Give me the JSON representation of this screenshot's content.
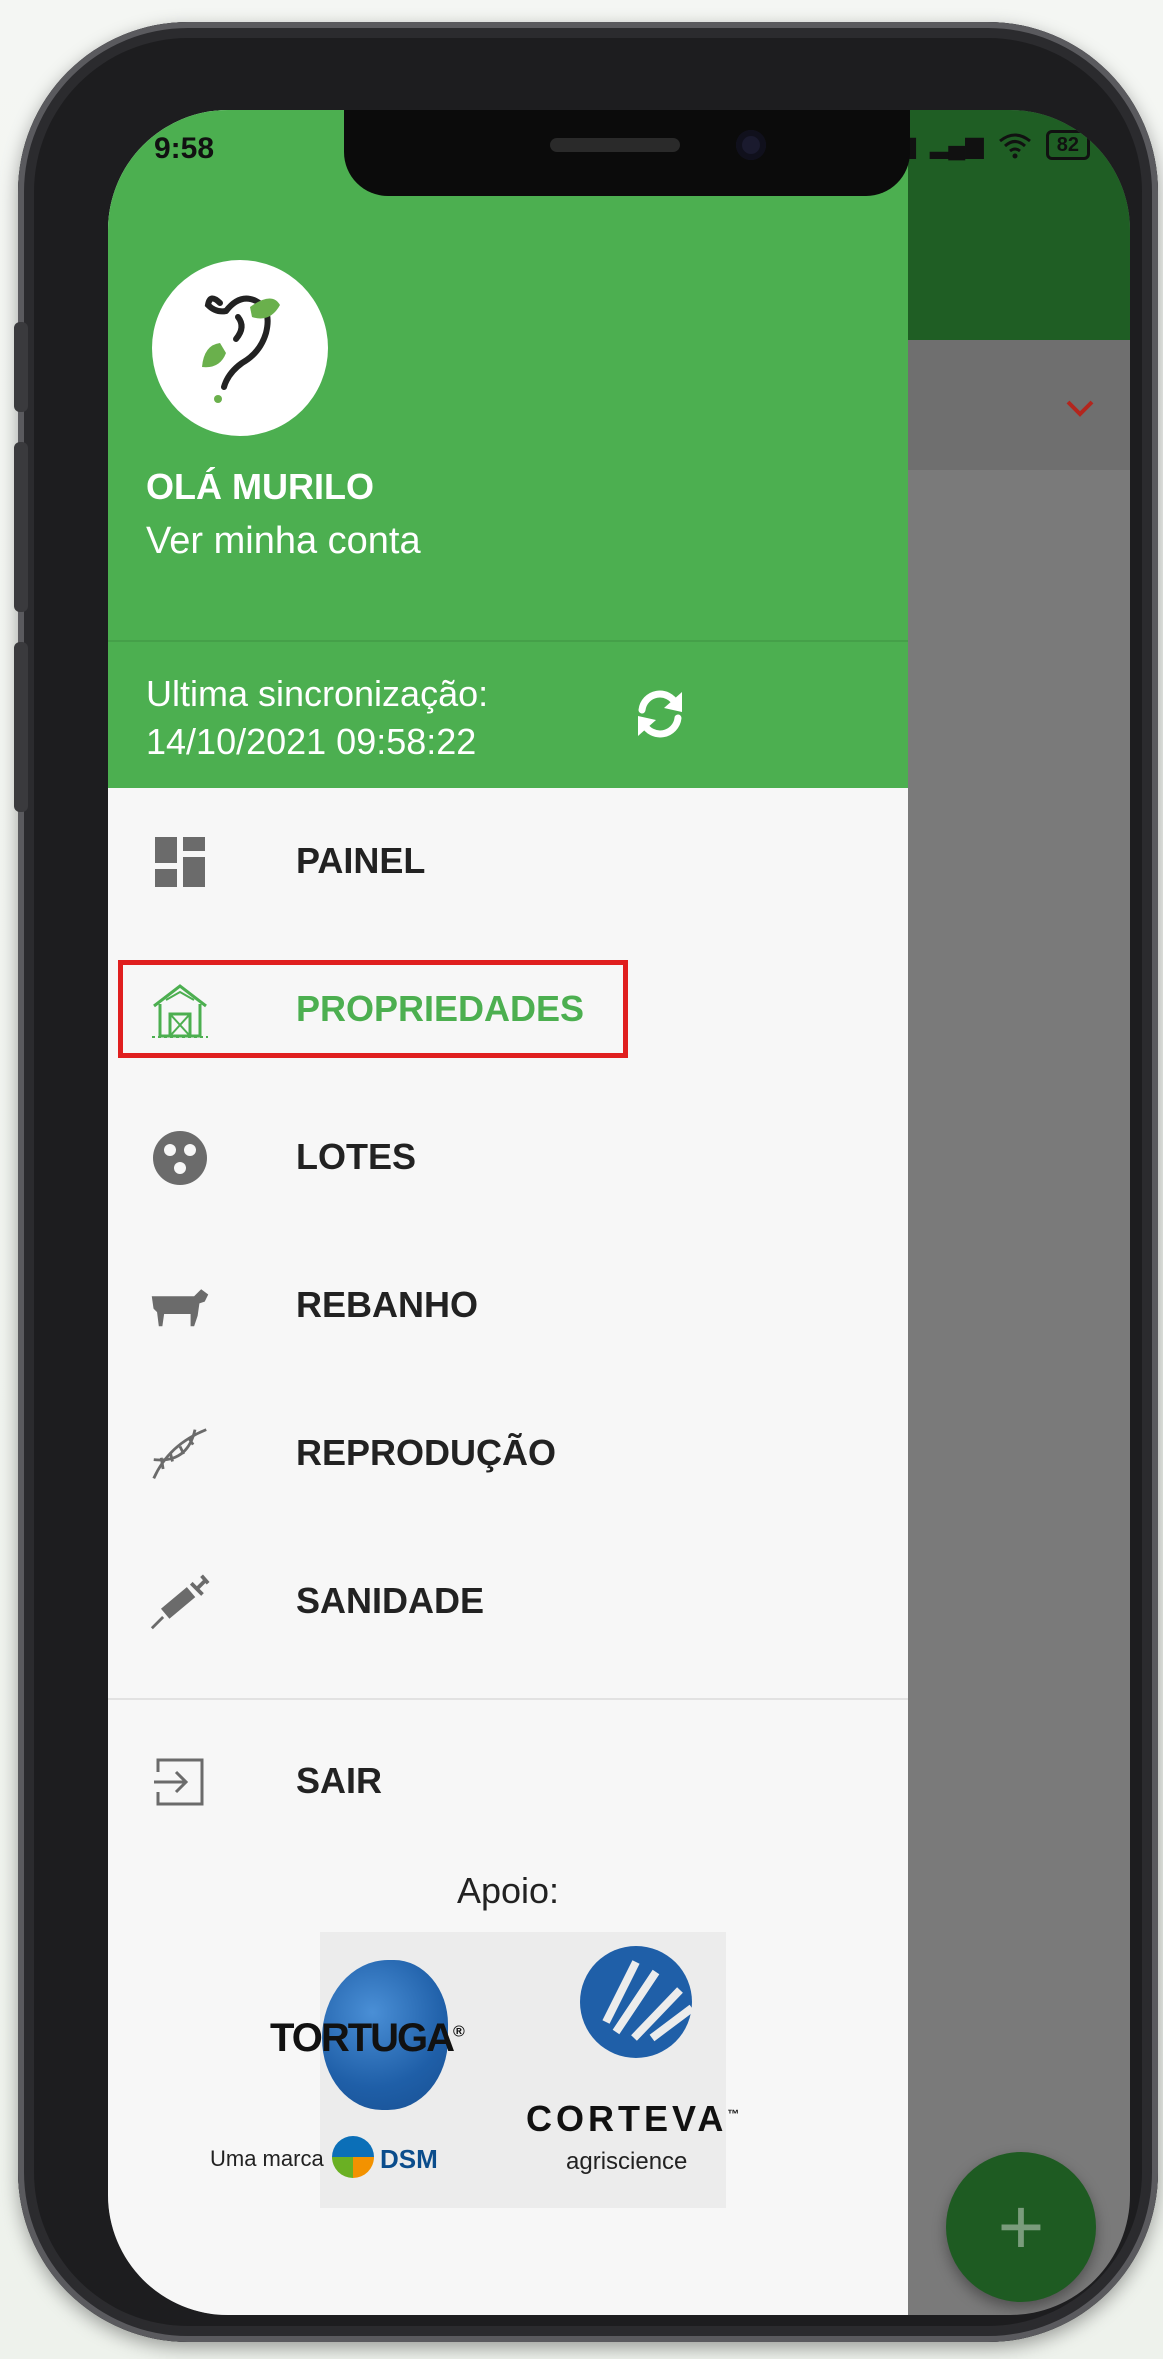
{
  "status_bar": {
    "time": "9:58",
    "battery": "82"
  },
  "drawer": {
    "greeting": "OLÁ MURILO",
    "account_link": "Ver minha conta",
    "sync_label": "Ultima sincronização:",
    "sync_time": "14/10/2021 09:58:22",
    "menu": [
      {
        "label": "PAINEL",
        "icon": "dashboard-icon",
        "active": false
      },
      {
        "label": "PROPRIEDADES",
        "icon": "barn-icon",
        "active": true
      },
      {
        "label": "LOTES",
        "icon": "lots-icon",
        "active": false
      },
      {
        "label": "REBANHO",
        "icon": "cow-icon",
        "active": false
      },
      {
        "label": "REPRODUÇÃO",
        "icon": "dna-icon",
        "active": false
      },
      {
        "label": "SANIDADE",
        "icon": "syringe-icon",
        "active": false
      }
    ],
    "logout_label": "SAIR",
    "support_label": "Apoio:",
    "sponsors": {
      "tortuga": "TORTUGA",
      "tortuga_mark": "®",
      "tortuga_sub": "Uma marca",
      "dsm": "DSM",
      "corteva": "CORTEVA",
      "corteva_mark": "™",
      "corteva_sub": "agriscience"
    }
  },
  "fab": {
    "symbol": "+"
  },
  "colors": {
    "primary": "#4caf50",
    "dark_primary": "#1f5e24",
    "highlight": "#e01f1f"
  }
}
